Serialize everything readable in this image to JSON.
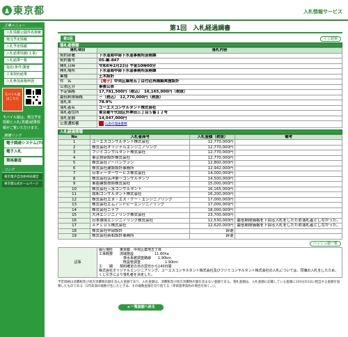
{
  "header": {
    "logo_text": "東京都",
    "service_name": "入札情報サービス"
  },
  "sidebar": {
    "menu_title": "工事メニュー",
    "menu_items": [
      "入札情報公開件名検索",
      "発注予定情報",
      "入札予定情報",
      "入札結果情報(工事)",
      "入札結果一覧",
      "指名(条件)業者",
      "工事契約結果",
      "入札参加資格申請"
    ],
    "mobile_box": "モバイル版\nはこちら",
    "mobile_note": "モバイル版は、発注予定情報と入札(見積)結果情報がご覧いただけます。",
    "links_title": "関連リンク",
    "link_items": [
      "電子調達システム(TOP)",
      "電子入札",
      "資格審査"
    ],
    "related_title": "リンク",
    "related_items": [
      "東京電子自治体共同運営",
      "東京都公式ホームページ"
    ]
  },
  "page": {
    "title": "第1回　入札経過調書",
    "item_label": "第1回",
    "close_button": "くじ結果",
    "section_info": "落札者情報",
    "info_header": {
      "col1": "落札項目",
      "col2": "落札内容"
    },
    "info_rows": [
      {
        "label": "契約部署",
        "value": "下水道局中部下水道事務所庶務課"
      },
      {
        "label": "契約番号",
        "value": "05-業-847"
      },
      {
        "label": "開札日時",
        "value": "令和6年2月22日 午前10時00分"
      },
      {
        "label": "開札場所",
        "value": "下水道局中部下水道事務所庶務課"
      },
      {
        "label": "業種",
        "value": "土木設計"
      },
      {
        "label": "件　名",
        "value": "中央区築地五丁目付近再構築実施設計",
        "tag": "【電子】"
      },
      {
        "label": "公表区分",
        "value": "事後公表"
      },
      {
        "label": "予定価格",
        "value": "17,781,500円（税込）　16,165,000円（税抜）"
      },
      {
        "label": "最低制限価格",
        "value": "－（税込）　12,770,000円（税抜）"
      },
      {
        "label": "落札率",
        "value": "78.9%"
      },
      {
        "label": "落札者名",
        "value": "ユーエスコンサルタント株式会社"
      },
      {
        "label": "落札者住所",
        "value": "東京都千代田区外神田三丁目５番１２号"
      },
      {
        "label": "落札金額",
        "value": "14,047,000円"
      },
      {
        "label": "公表通知書",
        "value": "公表の理由書類"
      }
    ],
    "section_bids": "入札経過情報",
    "bid_header": {
      "no": "No",
      "name": "入札者商号",
      "amount": "入札金額（税抜）",
      "note": "備考"
    },
    "bids": [
      {
        "no": "1",
        "name": "ユーエスコンサルタント株式会社",
        "amount": "12,770,000円",
        "note": ""
      },
      {
        "no": "2",
        "name": "株式会社オリジナルエンジニアリング",
        "amount": "12,770,000円",
        "note": ""
      },
      {
        "no": "3",
        "name": "フジミコンサルタント株式会社",
        "amount": "12,770,000円",
        "note": ""
      },
      {
        "no": "4",
        "name": "東京技研設計株式会社",
        "amount": "12,770,000円",
        "note": ""
      },
      {
        "no": "5",
        "name": "株式会社アーバンプラン",
        "amount": "12,800,000円",
        "note": ""
      },
      {
        "no": "6",
        "name": "株式会社建設設計事務所",
        "amount": "12,942,000円",
        "note": ""
      },
      {
        "no": "7",
        "name": "日本データーサービス株式会社",
        "amount": "14,000,000円",
        "note": ""
      },
      {
        "no": "8",
        "name": "株式会社弘洋第一コンサルタンツ",
        "amount": "14,500,000円",
        "note": ""
      },
      {
        "no": "9",
        "name": "東亜建設技術株式会社",
        "amount": "15,000,000円",
        "note": ""
      },
      {
        "no": "10",
        "name": "株式会社三水コンサルタント",
        "amount": "16,165,000円",
        "note": ""
      },
      {
        "no": "11",
        "name": "成和コンサルタント株式会社",
        "amount": "16,200,000円",
        "note": ""
      },
      {
        "no": "12",
        "name": "株式会社エヌ・エス・ケー・エンジニアリング",
        "amount": "17,000,000円",
        "note": ""
      },
      {
        "no": "13",
        "name": "株式会社エムアンドピーエンジニアリング",
        "amount": "17,000,000円",
        "note": ""
      },
      {
        "no": "14",
        "name": "株式会社ニチフ",
        "amount": "18,000,000円",
        "note": ""
      },
      {
        "no": "15",
        "name": "大洋エンジニアリング株式会社",
        "amount": "23,700,000円",
        "note": ""
      },
      {
        "no": "16",
        "name": "日本環境エンジニアリング株式会社",
        "amount": "12,530,000円",
        "note": "最低制限価格を下回る入札をしたため落札者としなかった。"
      },
      {
        "no": "17",
        "name": "ＡＰＬＵＳ株式会社",
        "amount": "12,620,000円",
        "note": "最低制限価格を下回る入札をしたため落札者としなかった。"
      },
      {
        "no": "18",
        "name": "株式会社中部設計",
        "amount": "辞退",
        "note": ""
      },
      {
        "no": "19",
        "name": "株式会社新和設計事務所",
        "amount": "辞退",
        "note": ""
      }
    ],
    "lottery_button": "ハッシュ値一覧",
    "remarks_label": "記事",
    "remarks": [
      "履行場所　　東京都　中央区築地五丁目",
      "工事概要　　流域施設　　　　　　11.60ha",
      "　　　　　　　排水系統調査路線　　1.90km",
      "　　　　　　　既設管調査　　　　　　　1.90km",
      "工　　期　　契約確定の日の翌日から140日間",
      "株式会社オリジナルエンジニアリング、ユーエスコンサルタント株式会社及びフジミコンサルタント株式会社の入札については、同価の入札をしたため、くじ引きにより落札者を決定した。"
    ],
    "footnote": "予定価格は消費税及び地方消費税の額を含んだ金額であり、入札金額は、消費税及び地方消費税の額を含まない金額である。落札金額は、入札金額に記載している金額に100分の10に相当する金額を加算したものである（1円未満の端数が生じたときは、その端数金額を切り捨てる（単価基準契約の場合を除く。））。",
    "back_button": "◄ 一覧画面へ戻る"
  },
  "colors": {
    "accent": "#2e9a3e",
    "dark": "#1f6e2a",
    "red": "#cc0000"
  }
}
